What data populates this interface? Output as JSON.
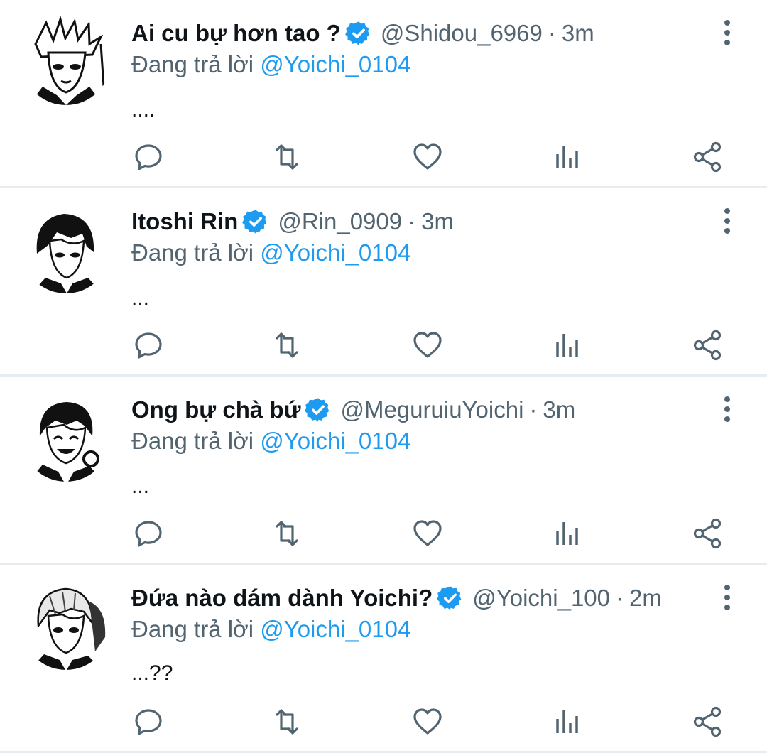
{
  "colors": {
    "text_primary": "#0f1419",
    "text_secondary": "#536471",
    "accent": "#1d9bf0",
    "separator": "#e6ecf0",
    "icon": "#536471"
  },
  "icons": {
    "verified": "verified-badge-icon",
    "more": "more-vertical-icon",
    "reply": "reply-icon",
    "retweet": "retweet-icon",
    "like": "heart-icon",
    "views": "views-chart-icon",
    "share": "share-icon"
  },
  "tweets": [
    {
      "name": "Ai cu bự hơn tao ?",
      "handle": "@Shidou_6969",
      "separator": "·",
      "time": "3m",
      "reply_prefix": "Đang trả lời",
      "reply_to": "@Yoichi_0104",
      "text": "...."
    },
    {
      "name": "Itoshi Rin",
      "handle": "@Rin_0909",
      "separator": "·",
      "time": "3m",
      "reply_prefix": "Đang trả lời",
      "reply_to": "@Yoichi_0104",
      "text": "..."
    },
    {
      "name": "Ong bự chà bứ",
      "handle": "@MeguruiuYoichi",
      "separator": "·",
      "time": "3m",
      "reply_prefix": "Đang trả lời",
      "reply_to": "@Yoichi_0104",
      "text": "..."
    },
    {
      "name": "Đứa nào dám dành Yoichi?",
      "handle": "@Yoichi_100",
      "separator": "·",
      "time": "2m",
      "reply_prefix": "Đang trả lời",
      "reply_to": "@Yoichi_0104",
      "text": "...??"
    }
  ]
}
